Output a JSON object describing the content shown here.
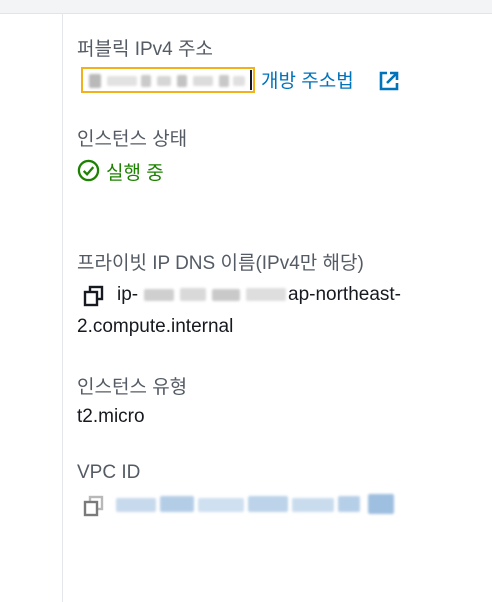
{
  "public_ipv4": {
    "label": "퍼블릭 IPv4 주소",
    "open_link": "개방 주소법"
  },
  "instance_state": {
    "label": "인스턴스 상태",
    "value": "실행 중"
  },
  "private_dns": {
    "label": "프라이빗 IP DNS 이름(IPv4만 해당)",
    "prefix": "ip-",
    "suffix": "ap-northeast-",
    "line2": "2.compute.internal"
  },
  "instance_type": {
    "label": "인스턴스 유형",
    "value": "t2.micro"
  },
  "vpc_id": {
    "label": "VPC ID"
  },
  "colors": {
    "link": "#0073bb",
    "running": "#1d8102",
    "focus_border": "#f2b11b"
  }
}
